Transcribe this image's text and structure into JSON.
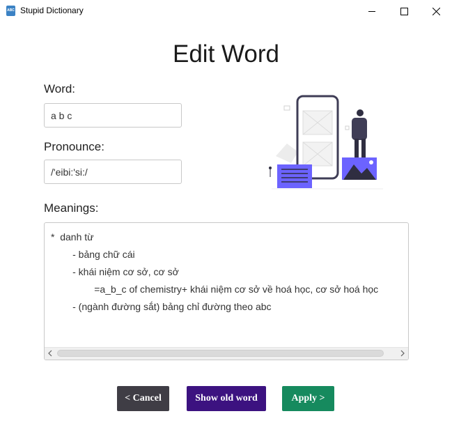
{
  "window": {
    "title": "Stupid Dictionary",
    "icon": "dictionary-app-icon",
    "icon_text": "ABC",
    "controls": [
      "minimize",
      "maximize",
      "close"
    ]
  },
  "page": {
    "heading": "Edit Word"
  },
  "form": {
    "word_label": "Word:",
    "word_value": "a b c",
    "pronounce_label": "Pronounce:",
    "pronounce_value": "/'eibi:'si:/",
    "meanings_label": "Meanings:",
    "meanings_value": "*  danh từ\n        - bảng chữ cái\n        - khái niệm cơ sở, cơ sở\n                =a_b_c of chemistry+ khái niệm cơ sở về hoá học, cơ sở hoá học\n        - (ngành đường sắt) bảng chỉ đường theo abc"
  },
  "buttons": {
    "cancel_label": "< Cancel",
    "show_old_label": "Show old word",
    "apply_label": "Apply >"
  },
  "colors": {
    "cancel": "#3f3d45",
    "show_old": "#3c1280",
    "apply": "#168a5e",
    "illustration_accent": "#6c63ff"
  }
}
